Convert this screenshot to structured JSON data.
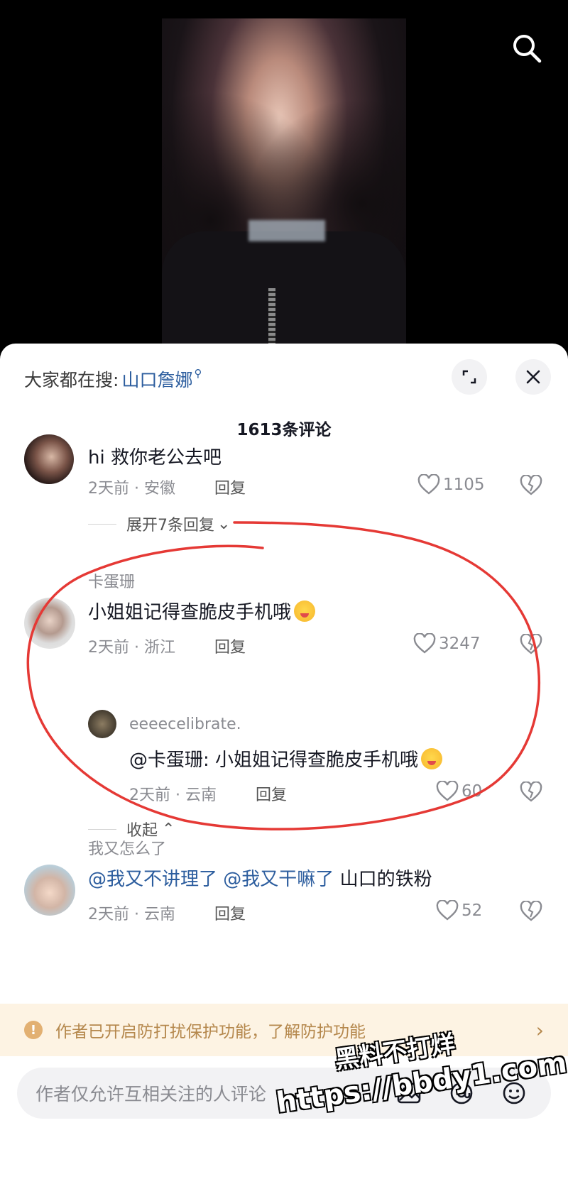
{
  "video": {
    "search_icon": "search-icon"
  },
  "sheet": {
    "trend_prefix": "大家都在搜:",
    "trend_keyword": "山口詹娜",
    "trend_icon": "search-small-icon",
    "expand_icon": "expand-icon",
    "close_icon": "close-icon",
    "comment_count_title": "1613条评论"
  },
  "comments": [
    {
      "text": "hi 救你老公去吧",
      "time": "2天前",
      "location": "安徽",
      "reply_label": "回复",
      "likes": "1105",
      "expand_label": "展开7条回复"
    },
    {
      "username": "卡蛋珊",
      "text": "小姐姐记得查脆皮手机哦",
      "time": "2天前",
      "location": "浙江",
      "reply_label": "回复",
      "likes": "3247",
      "sub_reply": {
        "username": "eeeecelibrate.",
        "text": "@卡蛋珊: 小姐姐记得查脆皮手机哦",
        "time": "2天前",
        "location": "云南",
        "reply_label": "回复",
        "likes": "60"
      },
      "collapse_label": "收起"
    },
    {
      "username": "我又怎么了",
      "mention1": "@我又不讲理了",
      "mention2": "@我又干嘛了",
      "text_after": "山口的铁粉",
      "time": "2天前",
      "location": "云南",
      "reply_label": "回复",
      "likes": "52"
    }
  ],
  "notice": {
    "text": "作者已开启防打扰保护功能，了解防护功能",
    "icon": "info-icon"
  },
  "input": {
    "placeholder": "作者仅允许互相关注的人评论",
    "icons": [
      "image-icon",
      "at-icon",
      "emoji-icon"
    ]
  },
  "watermark": {
    "line1": "黑料不打烊",
    "line2": "https://bbdy1.com"
  },
  "colors": {
    "link": "#2c5d9e",
    "annotation": "#e53935",
    "notice_bg": "#fdf3e3",
    "notice_text": "#b5884d"
  }
}
